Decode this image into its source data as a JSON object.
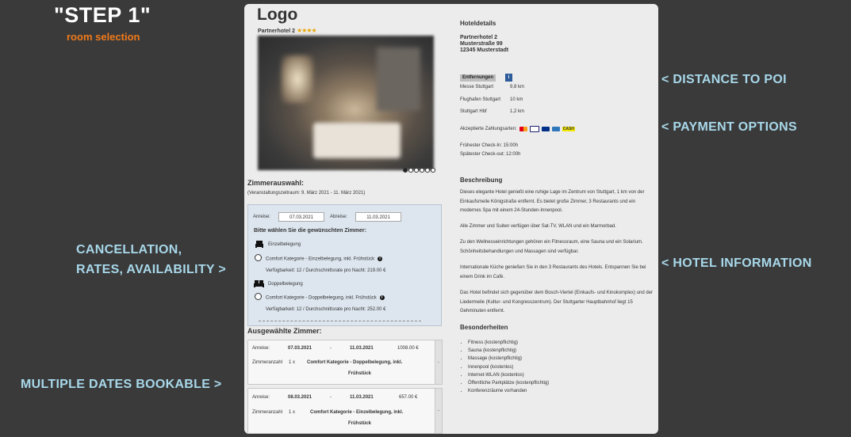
{
  "overlay": {
    "step_title": "\"STEP 1\"",
    "step_subtitle": "room selection",
    "notes": {
      "distance": "< DISTANCE TO POI",
      "payment": "< PAYMENT OPTIONS",
      "hotel_info": "< HOTEL INFORMATION",
      "cancellation_line1": "CANCELLATION,",
      "cancellation_line2": "RATES, AVAILABILITY >",
      "multiple_dates": "MULTIPLE DATES BOOKABLE >"
    },
    "note_color": "#a8d8ea",
    "subtitle_color": "#f07a1a"
  },
  "hotel": {
    "logo": "Logo",
    "name": "Partnerhotel 2",
    "stars": "★★★★",
    "carousel_dots": 6
  },
  "room_selection": {
    "heading": "Zimmerauswahl:",
    "period": "(Veranstaltungszeitraum: 9. März 2021 - 11. März 2021)",
    "arrival_label": "Anreise:",
    "arrival_value": "07.03.2021",
    "departure_label": "Abreise:",
    "departure_value": "11.03.2021",
    "prompt": "Bitte wählen Sie die gewünschten Zimmer:",
    "rooms": [
      {
        "type": "Einzelbelegung",
        "option": "Comfort Kategorie - Einzelbelegung, inkl. Frühstück",
        "availability": "Verfügbarkeit: 12 / Durchschnittsrate pro Nacht: 219.00 €"
      },
      {
        "type": "Doppelbelegung",
        "option": "Comfort Kategorie - Doppelbelegung, inkl. Frühstück",
        "availability": "Verfügbarkeit: 12 / Durchschnittsrate pro Nacht: 252.00 €"
      }
    ]
  },
  "selected_rooms": {
    "heading": "Ausgewählte Zimmer:",
    "arrival_label": "Anreise:",
    "count_label": "Zimmeranzahl",
    "dash": "-",
    "scroll_symbol": "-",
    "items": [
      {
        "from": "07.03.2021",
        "to": "11.03.2021",
        "price": "1008.00 €",
        "qty": "1 x",
        "name_line1": "Comfort Kategorie - Doppelbelegung, inkl.",
        "name_line2": "Frühstück"
      },
      {
        "from": "08.03.2021",
        "to": "11.03.2021",
        "price": "657.00 €",
        "qty": "1 x",
        "name_line1": "Comfort Kategorie - Einzelbelegung, inkl.",
        "name_line2": "Frühstück"
      }
    ]
  },
  "details": {
    "heading": "Hoteldetails",
    "address": [
      "Partnerhotel 2",
      "Musterstraße 99",
      "12345 Musterstadt"
    ],
    "distances_label": "Entfernungen",
    "distances_info": "i",
    "distances": [
      {
        "place": "Messe Stuttgart",
        "value": "9,8 km"
      },
      {
        "place": "Flughafen Stuttgart",
        "value": "10 km"
      },
      {
        "place": "Stuttgart Hbf",
        "value": "1,2 km"
      }
    ],
    "payment_label": "Akzeptierte Zahlungsarten:",
    "payment_cash": "CASH",
    "checkin": "Frühester Check-In: 15:00h",
    "checkout": "Spätester Check-out: 12:00h",
    "description_heading": "Beschreibung",
    "description": [
      "Dieses elegante Hotel genießt eine ruhige Lage im Zentrum von Stuttgart, 1 km von der Einkaufsmeile Königstraße entfernt. Es bietet große Zimmer, 3 Restaurants und ein modernes Spa mit einem 24-Stunden-Innenpool.",
      "Alle Zimmer und Suiten verfügen über Sat-TV, WLAN und ein Marmorbad.",
      "Zu den Wellnesseinrichtungen gehören ein Fitnessraum, eine Sauna und ein Solarium. Schönheitsbehandlungen und Massagen sind verfügbar.",
      "Internationale Küche genießen Sie in den 3 Restaurants des Hotels. Entspannen Sie bei einem Drink im Café.",
      "Das Hotel befindet sich gegenüber dem Bosch-Viertel (Einkaufs- und Kinokomplex) und der Liedermeile (Kultur- und Kongresszentrum). Der Stuttgarter Hauptbahnhof liegt 15 Gehminuten entfernt."
    ],
    "features_heading": "Besonderheiten",
    "features": [
      "Fitness (kostenpflichtig)",
      "Sauna (kostenpflichtig)",
      "Massage (kostenpflichtig)",
      "Innenpool (kostenlos)",
      "Internet-WLAN (kostenlos)",
      "Öffentliche Parkplätze (kostenpflichtig)",
      "Konferenzräume vorhanden"
    ]
  }
}
